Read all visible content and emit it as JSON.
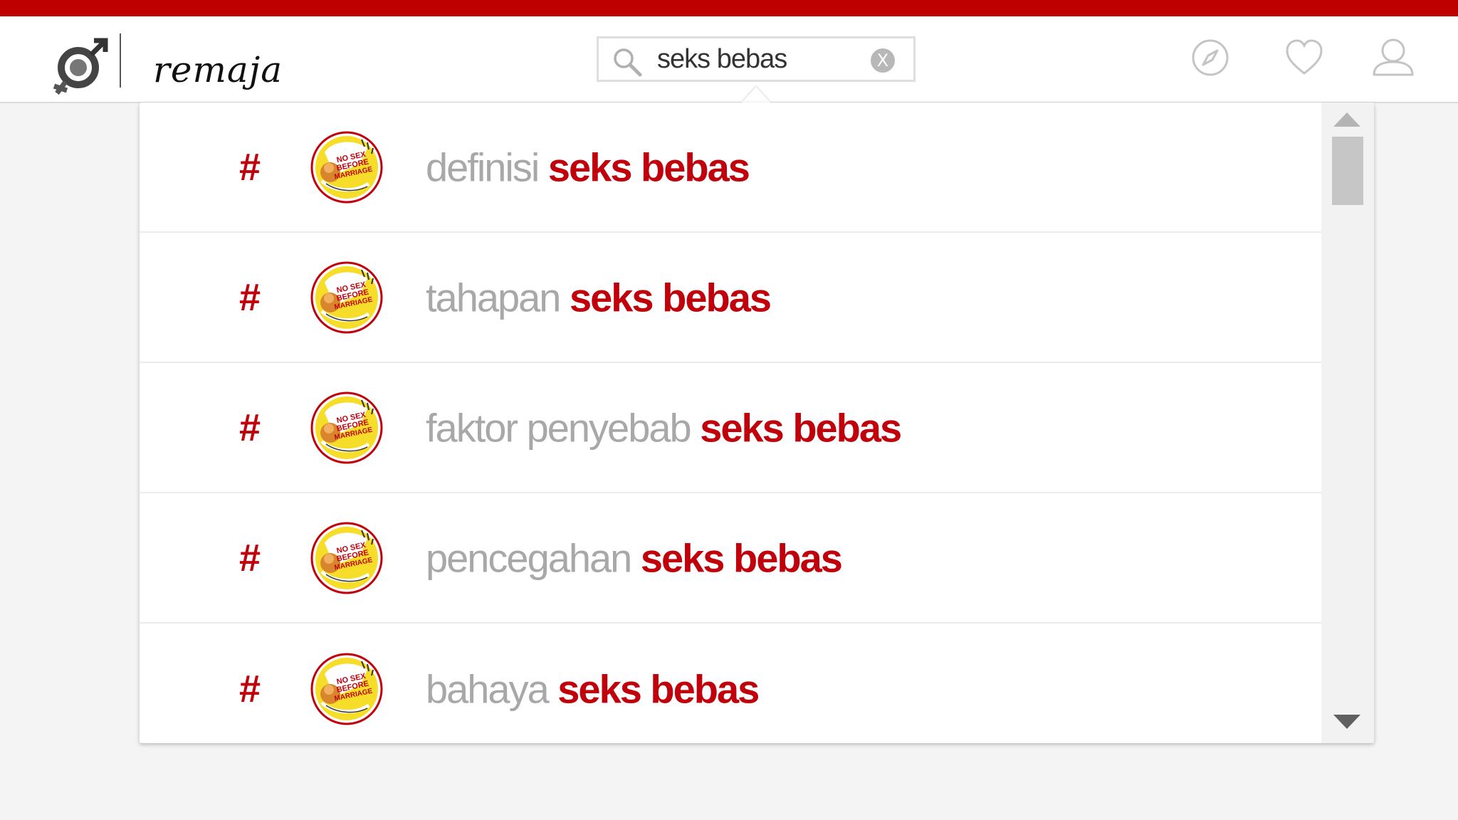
{
  "app": {
    "brand": "remaja"
  },
  "search": {
    "value": "seks bebas",
    "clear_label": "X"
  },
  "header_icons": [
    "compass-icon",
    "heart-icon",
    "user-icon"
  ],
  "colors": {
    "accent": "#c0000b",
    "topbar": "#bf0000",
    "muted_text": "#a8a8a8"
  },
  "suggestions": [
    {
      "hash": "#",
      "prefix": "definisi",
      "keyword": "seks bebas",
      "thumb": "no-sex-before-marriage-badge"
    },
    {
      "hash": "#",
      "prefix": "tahapan",
      "keyword": "seks bebas",
      "thumb": "no-sex-before-marriage-badge"
    },
    {
      "hash": "#",
      "prefix": "faktor penyebab",
      "keyword": "seks bebas",
      "thumb": "no-sex-before-marriage-badge"
    },
    {
      "hash": "#",
      "prefix": "pencegahan",
      "keyword": "seks bebas",
      "thumb": "no-sex-before-marriage-badge"
    },
    {
      "hash": "#",
      "prefix": "bahaya ",
      "keyword": "seks bebas",
      "thumb": "no-sex-before-marriage-badge"
    }
  ],
  "thumb_text": "NO SEX BEFORE MARRIAGE"
}
